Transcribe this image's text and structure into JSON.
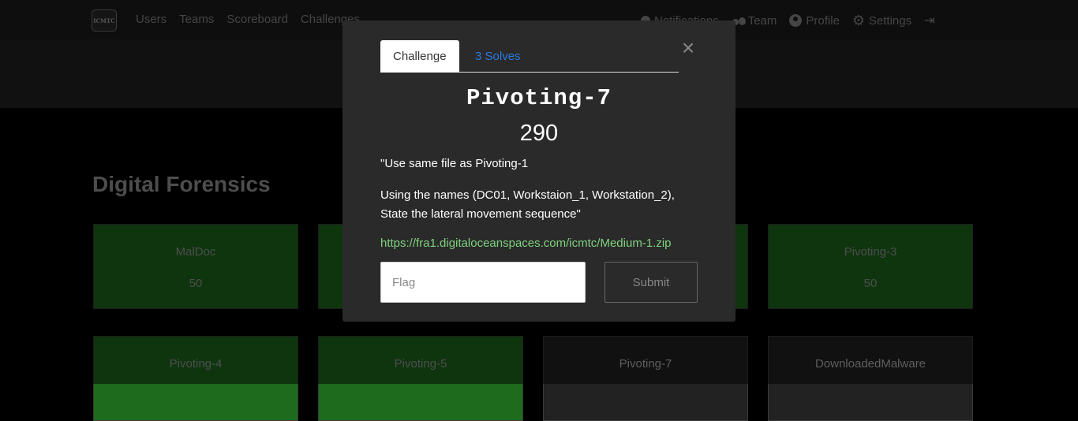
{
  "navbar": {
    "logo_text": "ICMTC",
    "left_links": [
      {
        "label": "Users"
      },
      {
        "label": "Teams"
      },
      {
        "label": "Scoreboard"
      },
      {
        "label": "Challenges"
      }
    ],
    "right_links": [
      {
        "label": "Notifications",
        "icon": "bell-icon"
      },
      {
        "label": "Team",
        "icon": "users-icon"
      },
      {
        "label": "Profile",
        "icon": "user-circle-icon"
      },
      {
        "label": "Settings",
        "icon": "gears-icon"
      }
    ],
    "logout_icon": "sign-out-icon"
  },
  "category": "Digital Forensics",
  "cards": [
    {
      "name": "MalDoc",
      "value": "50",
      "solved": true
    },
    {
      "name": "",
      "value": "",
      "solved": true
    },
    {
      "name": "",
      "value": "",
      "solved": true
    },
    {
      "name": "Pivoting-3",
      "value": "50",
      "solved": true
    },
    {
      "name": "Pivoting-4",
      "value": "",
      "solved": true
    },
    {
      "name": "Pivoting-5",
      "value": "",
      "solved": true
    },
    {
      "name": "Pivoting-7",
      "value": "",
      "solved": false
    },
    {
      "name": "DownloadedMalware",
      "value": "",
      "solved": false
    }
  ],
  "modal": {
    "tabs": {
      "challenge": "Challenge",
      "solves": "3 Solves"
    },
    "close_symbol": "×",
    "title": "Pivoting-7",
    "value": "290",
    "description_line1": "\"Use same file as Pivoting-1",
    "description_line2": "Using the names (DC01, Workstaion_1, Workstation_2), State the lateral movement sequence\"",
    "link": "https://fra1.digitaloceanspaces.com/icmtc/Medium-1.zip",
    "flag_placeholder": "Flag",
    "submit_label": "Submit"
  },
  "colors": {
    "solved_card": "#1e6b1e",
    "link_green": "#7ed27e",
    "tab_blue": "#2a7ae2"
  }
}
